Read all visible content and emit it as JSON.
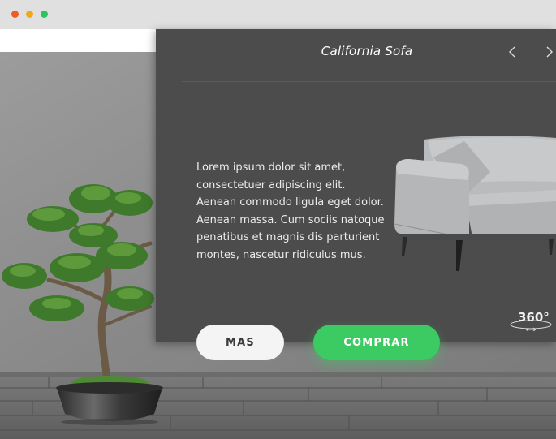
{
  "window": {
    "controls": [
      "close",
      "minimize",
      "zoom"
    ],
    "control_colors": {
      "close": "#ef5b26",
      "minimize": "#f2a81b",
      "zoom": "#2ac55f"
    }
  },
  "product": {
    "title": "California Sofa",
    "description_lines": [
      "Lorem ipsum dolor sit amet,",
      "consectetuer adipiscing elit.",
      "Aenean commodo ligula eget dolor.",
      "Aenean massa. Cum sociis natoque",
      "penatibus et magnis dis parturient",
      "montes, nascetur ridiculus mus."
    ],
    "view_badge": "360°"
  },
  "nav": {
    "prev_icon": "chevron-left-icon",
    "next_icon": "chevron-right-icon"
  },
  "actions": {
    "more_label": "MAS",
    "buy_label": "COMPRAR"
  },
  "colors": {
    "panel": "#4c4c4c",
    "accent": "#3cca63",
    "more_button": "#f4f4f4"
  }
}
